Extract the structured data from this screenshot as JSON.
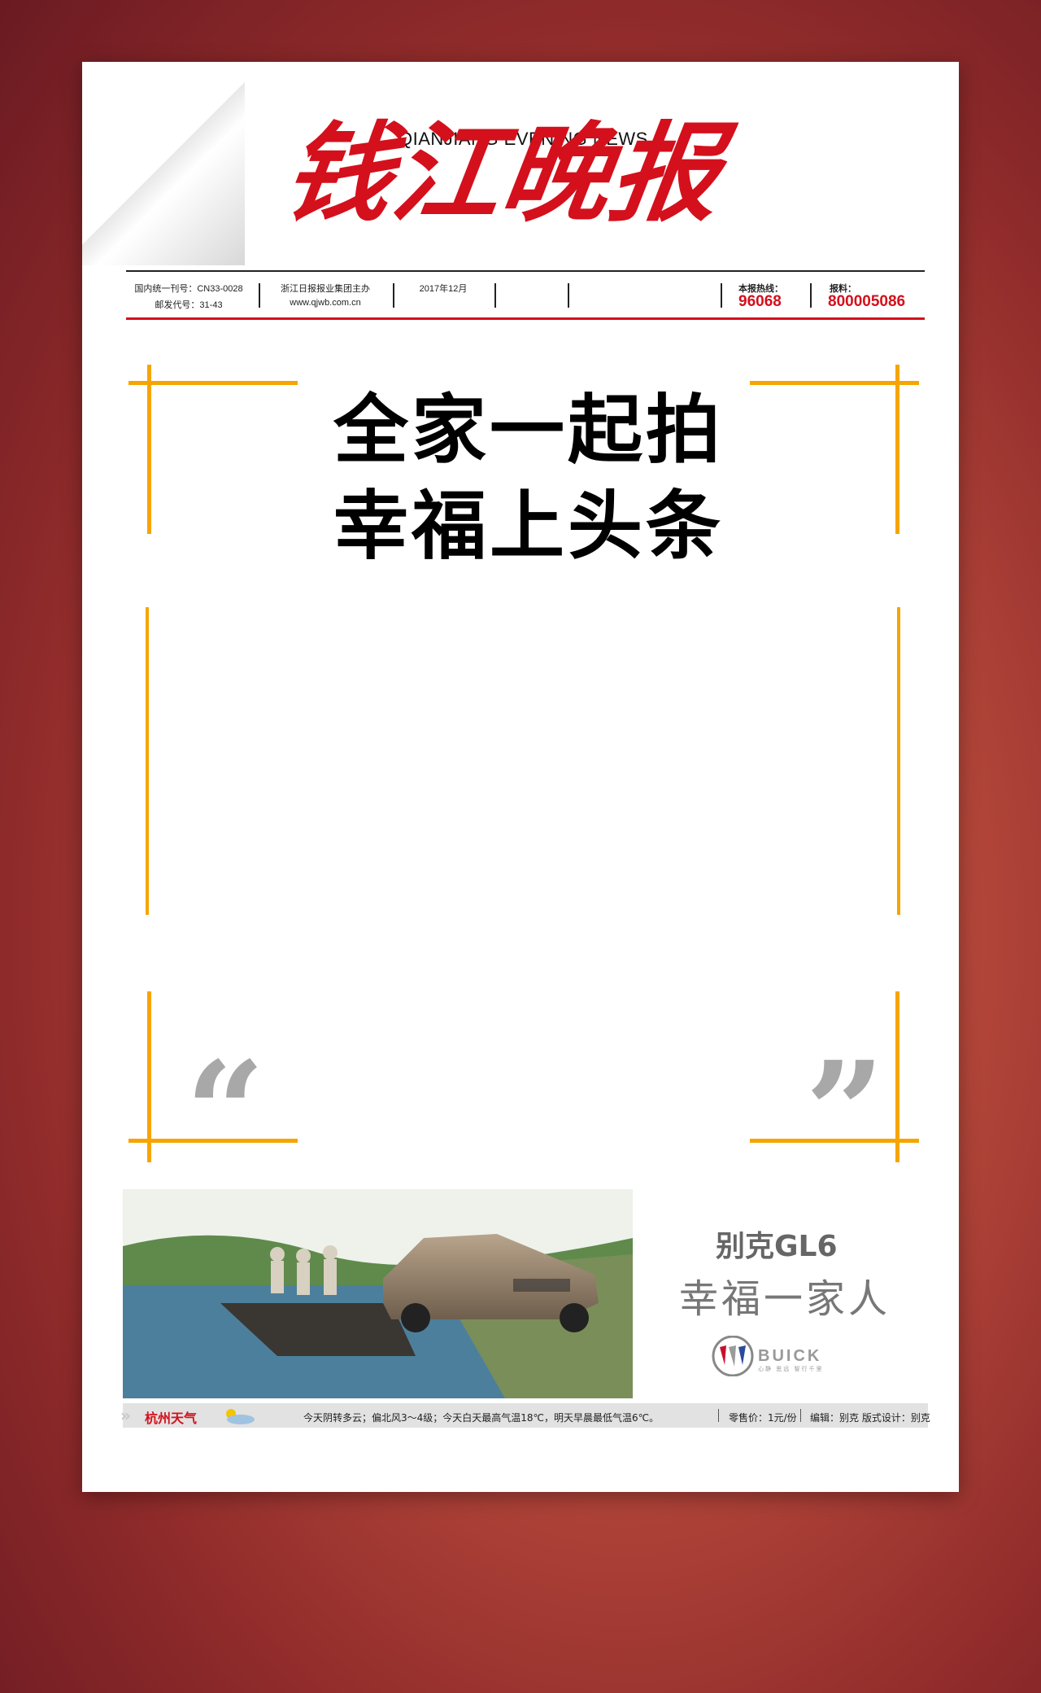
{
  "masthead": {
    "title_cn": "钱江晚报",
    "title_en": "QIANJIANG EVENING NEWS"
  },
  "infobar": {
    "issn_line1": "国内统一刊号：CN33-0028",
    "issn_line2": "邮发代号：31-43",
    "publisher": "浙江日报报业集团主办",
    "website": "www.qjwb.com.cn",
    "date": "2017年12月",
    "hotline_label": "本报热线：",
    "hotline_number": "96068",
    "report_label": "报料：",
    "report_number": "800005086"
  },
  "headline": {
    "line1": "全家一起拍",
    "line2": "幸福上头条"
  },
  "quotes": {
    "open": "“",
    "close": "”"
  },
  "ad": {
    "model": "别克GL6",
    "slogan": "幸福一家人",
    "brand": "BUICK",
    "brand_tagline": "心静 思远 智行千里"
  },
  "weather": {
    "city": "杭州天气",
    "forecast": "今天阴转多云；偏北风3～4级；今天白天最高气温18℃，明天早晨最低气温6℃。",
    "price": "零售价：1元/份",
    "editors": "编辑：别克  版式设计：别克"
  },
  "colors": {
    "brand_red": "#d4101c",
    "accent_orange": "#f6a500"
  }
}
